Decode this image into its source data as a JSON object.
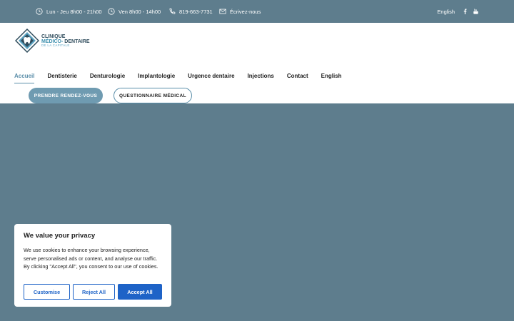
{
  "topbar": {
    "hours_1": "Lun - Jeu 8h00 - 21h00",
    "hours_2": "Ven 8h00 - 14h00",
    "phone": "819-663-7731",
    "email_label": "Écrivez-nous",
    "language": "English",
    "icons": [
      "clock-icon",
      "clock-icon",
      "phone-icon",
      "mail-icon",
      "facebook-icon",
      "youtube-icon"
    ]
  },
  "logo": {
    "line1": "CLINIQUE",
    "line2a": "MÉDICO-",
    "line2b": "DENTAIRE",
    "line3": "DE LA CAPITALE"
  },
  "nav": {
    "items": [
      {
        "label": "Accueil",
        "active": true
      },
      {
        "label": "Dentisterie"
      },
      {
        "label": "Denturologie"
      },
      {
        "label": "Implantologie"
      },
      {
        "label": "Urgence dentaire"
      },
      {
        "label": "Injections"
      },
      {
        "label": "Contact"
      },
      {
        "label": "English"
      }
    ]
  },
  "buttons": {
    "appointment": "PRENDRE RENDEZ-VOUS",
    "questionnaire": "QUESTIONNAIRE MÉDICAL"
  },
  "cookie": {
    "title": "We value your privacy",
    "text": "We use cookies to enhance your browsing experience, serve personalised ads or content, and analyse our traffic. By clicking \"Accept All\", you consent to our use of cookies.",
    "customise": "Customise",
    "reject": "Reject All",
    "accept": "Accept All"
  },
  "colors": {
    "brand": "#5e7d8d",
    "accent": "#5a8ea9",
    "cookie_button": "#1e63c7"
  }
}
